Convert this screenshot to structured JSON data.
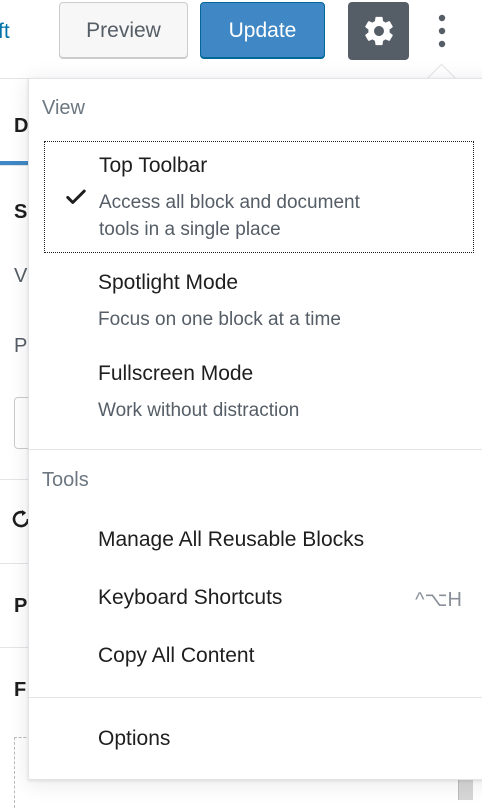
{
  "header": {
    "draft_link": "ft",
    "preview_label": "Preview",
    "update_label": "Update",
    "settings_icon": "gear-icon",
    "more_icon": "more-vertical-icon"
  },
  "background": {
    "letters": [
      "D",
      "S",
      "V",
      "P",
      "P",
      "F"
    ]
  },
  "menu": {
    "view_label": "View",
    "view_items": [
      {
        "title": "Top Toolbar",
        "desc_line1": "Access all block and document",
        "desc_line2": "tools in a single place",
        "checked": true
      },
      {
        "title": "Spotlight Mode",
        "desc_line1": "Focus on one block at a time"
      },
      {
        "title": "Fullscreen Mode",
        "desc_line1": "Work without distraction"
      }
    ],
    "tools_label": "Tools",
    "tools_items": [
      {
        "title": "Manage All Reusable Blocks"
      },
      {
        "title": "Keyboard Shortcuts",
        "shortcut": "^⌥H"
      },
      {
        "title": "Copy All Content"
      }
    ],
    "options_label": "Options"
  },
  "colors": {
    "accent": "#3f88c5",
    "settings_bg": "#555d66",
    "muted": "#6c7781"
  }
}
